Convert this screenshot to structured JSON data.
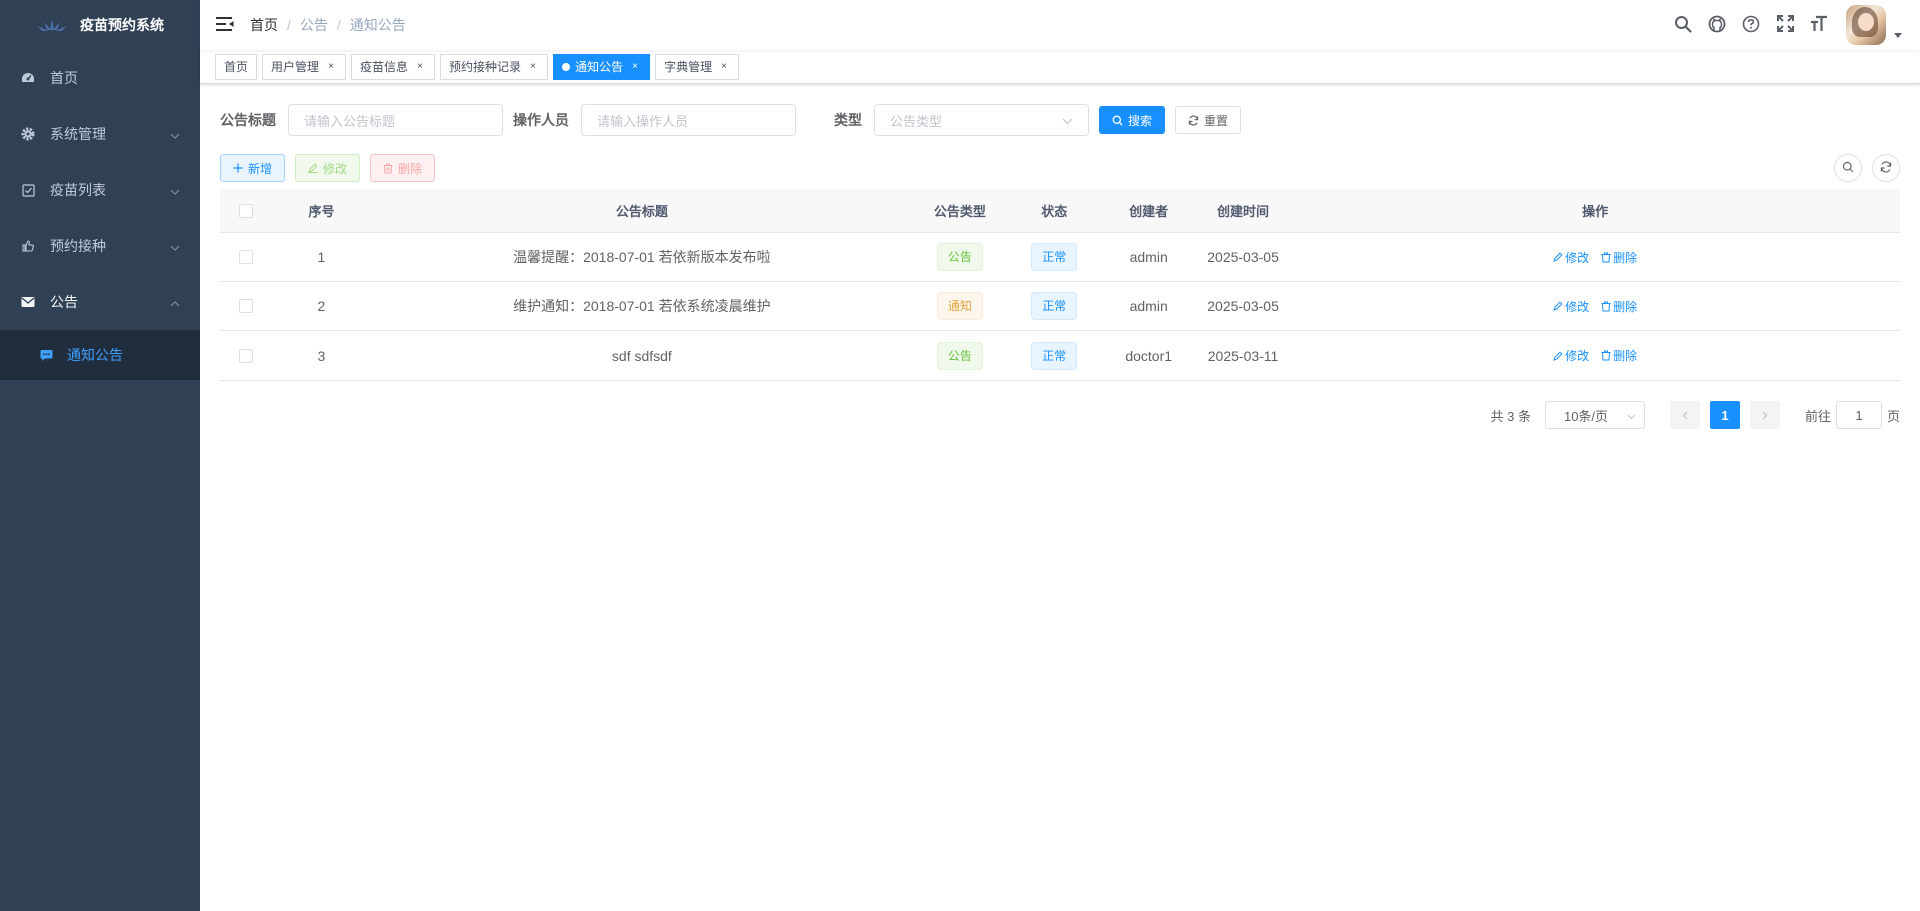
{
  "app": {
    "title": "疫苗预约系统"
  },
  "sidebar": {
    "items": [
      {
        "label": "首页",
        "icon": "dashboard-icon"
      },
      {
        "label": "系统管理",
        "icon": "gear-icon"
      },
      {
        "label": "疫苗列表",
        "icon": "checkbox-icon"
      },
      {
        "label": "预约接种",
        "icon": "thumb-icon"
      },
      {
        "label": "公告",
        "icon": "mail-icon"
      }
    ],
    "sub_items": [
      {
        "label": "通知公告",
        "icon": "message-icon"
      }
    ]
  },
  "breadcrumb": [
    "首页",
    "公告",
    "通知公告"
  ],
  "tags": [
    {
      "label": "首页",
      "closable": false
    },
    {
      "label": "用户管理",
      "closable": true
    },
    {
      "label": "疫苗信息",
      "closable": true
    },
    {
      "label": "预约接种记录",
      "closable": true
    },
    {
      "label": "通知公告",
      "closable": true,
      "active": true
    },
    {
      "label": "字典管理",
      "closable": true
    }
  ],
  "search": {
    "title_label": "公告标题",
    "title_placeholder": "请输入公告标题",
    "operator_label": "操作人员",
    "operator_placeholder": "请输入操作人员",
    "type_label": "类型",
    "type_placeholder": "公告类型",
    "search_label": "搜索",
    "reset_label": "重置"
  },
  "toolbar": {
    "add_label": "新增",
    "edit_label": "修改",
    "delete_label": "删除"
  },
  "table": {
    "headers": [
      "序号",
      "公告标题",
      "公告类型",
      "状态",
      "创建者",
      "创建时间",
      "操作"
    ],
    "rows": [
      {
        "idx": "1",
        "title": "温馨提醒：2018-07-01 若依新版本发布啦",
        "type": "公告",
        "type_style": "success",
        "status": "正常",
        "creator": "admin",
        "time": "2025-03-05",
        "edit": "修改",
        "delete": "删除"
      },
      {
        "idx": "2",
        "title": "维护通知：2018-07-01 若依系统凌晨维护",
        "type": "通知",
        "type_style": "warning",
        "status": "正常",
        "creator": "admin",
        "time": "2025-03-05",
        "edit": "修改",
        "delete": "删除"
      },
      {
        "idx": "3",
        "title": "sdf sdfsdf",
        "type": "公告",
        "type_style": "success",
        "status": "正常",
        "creator": "doctor1",
        "time": "2025-03-11",
        "edit": "修改",
        "delete": "删除"
      }
    ]
  },
  "pagination": {
    "total_text": "共 3 条",
    "page_size": "10条/页",
    "current_page": "1",
    "goto_label": "前往",
    "goto_value": "1",
    "page_unit": "页"
  },
  "colors": {
    "sidebar_bg": "#304156",
    "primary": "#1890ff",
    "active_menu": "#409eff"
  }
}
